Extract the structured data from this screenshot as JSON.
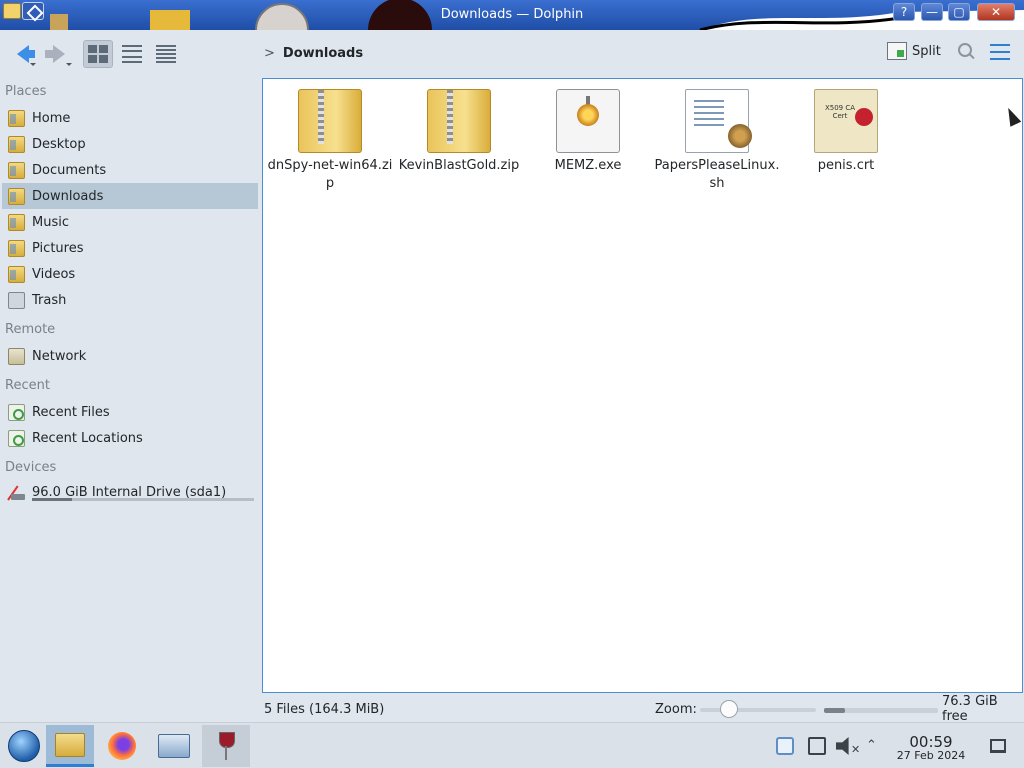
{
  "window": {
    "title": "Downloads — Dolphin",
    "buttons": {
      "help": "?",
      "minimize": "—",
      "maximize": "▢",
      "close": "✕"
    }
  },
  "toolbar": {
    "back_icon": "arrow-left",
    "forward_icon": "arrow-right",
    "view_modes": [
      "icons",
      "compact",
      "details"
    ],
    "active_view_mode": "icons",
    "breadcrumb_chevron": ">",
    "breadcrumb_current": "Downloads",
    "split_label": "Split",
    "search_icon": "search",
    "menu_icon": "hamburger-menu"
  },
  "sidebar": {
    "places_title": "Places",
    "places": [
      {
        "label": "Home",
        "icon": "home-folder"
      },
      {
        "label": "Desktop",
        "icon": "desktop-folder"
      },
      {
        "label": "Documents",
        "icon": "documents-folder"
      },
      {
        "label": "Downloads",
        "icon": "downloads-folder",
        "active": true
      },
      {
        "label": "Music",
        "icon": "music-folder"
      },
      {
        "label": "Pictures",
        "icon": "pictures-folder"
      },
      {
        "label": "Videos",
        "icon": "videos-folder"
      },
      {
        "label": "Trash",
        "icon": "trash"
      }
    ],
    "remote_title": "Remote",
    "remote": [
      {
        "label": "Network",
        "icon": "network-folder"
      }
    ],
    "recent_title": "Recent",
    "recent": [
      {
        "label": "Recent Files",
        "icon": "recent-files"
      },
      {
        "label": "Recent Locations",
        "icon": "recent-locations"
      }
    ],
    "devices_title": "Devices",
    "devices": [
      {
        "label": "96.0 GiB Internal Drive (sda1)",
        "icon": "hard-drive",
        "usage_fraction": 0.18
      }
    ]
  },
  "files": [
    {
      "name": "dnSpy-net-win64.zip",
      "icon": "zip-archive"
    },
    {
      "name": "KevinBlastGold.zip",
      "icon": "zip-archive"
    },
    {
      "name": "MEMZ.exe",
      "icon": "exe-gear",
      "hovered": true
    },
    {
      "name": "PapersPleaseLinux.sh",
      "icon": "shell-script"
    },
    {
      "name": "penis.crt",
      "icon": "certificate"
    }
  ],
  "statusbar": {
    "file_count": "5 Files (164.3 MiB)",
    "zoom_label": "Zoom:",
    "zoom_fraction": 0.2,
    "free_space": "76.3 GiB free",
    "used_fraction": 0.18
  },
  "taskbar": {
    "apps": [
      {
        "name": "start-menu",
        "state": "normal"
      },
      {
        "name": "dolphin",
        "state": "active"
      },
      {
        "name": "firefox",
        "state": "normal"
      },
      {
        "name": "system-settings",
        "state": "normal"
      },
      {
        "name": "wine",
        "state": "open"
      }
    ],
    "tray_icons": [
      "updates",
      "clipboard",
      "volume-muted",
      "expand-tray"
    ],
    "clock_time": "00:59",
    "clock_date": "27 Feb 2024",
    "show_desktop_icon": "show-desktop"
  },
  "colors": {
    "accent": "#2e7fd3",
    "selection": "#b6c7d5",
    "window_bg": "#dfe6ee",
    "view_border": "#4a8fd6"
  }
}
